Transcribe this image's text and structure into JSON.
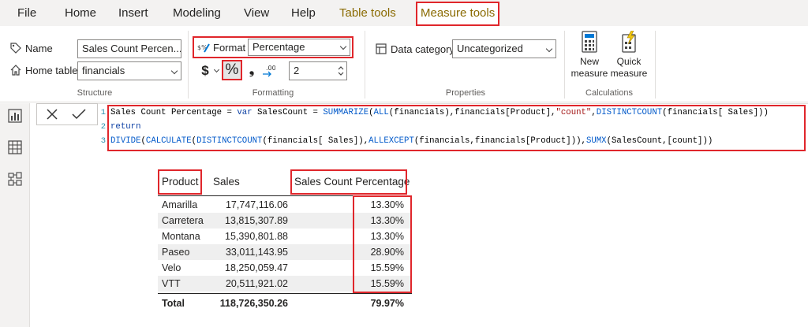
{
  "menu": {
    "tabs": [
      "File",
      "Home",
      "Insert",
      "Modeling",
      "View",
      "Help",
      "Table tools",
      "Measure tools"
    ]
  },
  "ribbon": {
    "structure": {
      "name_label": "Name",
      "name_value": "Sales Count Percen...",
      "home_table_label": "Home table",
      "home_table_value": "financials",
      "group_label": "Structure"
    },
    "formatting": {
      "format_label": "Format",
      "format_value": "Percentage",
      "currency_symbol": "$",
      "percent_symbol": "%",
      "comma_symbol": "❟",
      "decimals_value": "2",
      "group_label": "Formatting"
    },
    "properties": {
      "data_category_label": "Data category",
      "data_category_value": "Uncategorized",
      "group_label": "Properties"
    },
    "calculations": {
      "new_measure_line1": "New",
      "new_measure_line2": "measure",
      "quick_measure_line1": "Quick",
      "quick_measure_line2": "measure",
      "group_label": "Calculations"
    }
  },
  "formula": {
    "line_numbers": [
      "1",
      "2",
      "3"
    ],
    "line1": {
      "p1": "Sales Count Percentage = ",
      "kw1": "var",
      "p2": " SalesCount = ",
      "fn1": "SUMMARIZE",
      "p3": "(",
      "fn2": "ALL",
      "p4": "(financials),financials[Product],",
      "str1": "\"count\"",
      "p5": ",",
      "fn3": "DISTINCTCOUNT",
      "p6": "(financials[ Sales]))"
    },
    "line2": {
      "kw": "return"
    },
    "line3": {
      "fn1": "DIVIDE",
      "p1": "(",
      "fn2": "CALCULATE",
      "p2": "(",
      "fn3": "DISTINCTCOUNT",
      "p3": "(financials[ Sales]),",
      "fn4": "ALLEXCEPT",
      "p4": "(financials,financials[Product])),",
      "fn5": "SUMX",
      "p5": "(SalesCount,[count]))"
    }
  },
  "table": {
    "headers": [
      "Product",
      "Sales",
      "Sales Count Percentage"
    ],
    "rows": [
      [
        "Amarilla",
        "17,747,116.06",
        "13.30%"
      ],
      [
        "Carretera",
        "13,815,307.89",
        "13.30%"
      ],
      [
        "Montana",
        "15,390,801.88",
        "13.30%"
      ],
      [
        "Paseo",
        "33,011,143.95",
        "28.90%"
      ],
      [
        "Velo",
        "18,250,059.47",
        "15.59%"
      ],
      [
        "VTT",
        "20,511,921.02",
        "15.59%"
      ]
    ],
    "total": [
      "Total",
      "118,726,350.26",
      "79.97%"
    ]
  },
  "colors": {
    "highlight": "#e0262b",
    "context_tab": "#8a6a00",
    "ribbon_bg": "#f3f2f1"
  }
}
